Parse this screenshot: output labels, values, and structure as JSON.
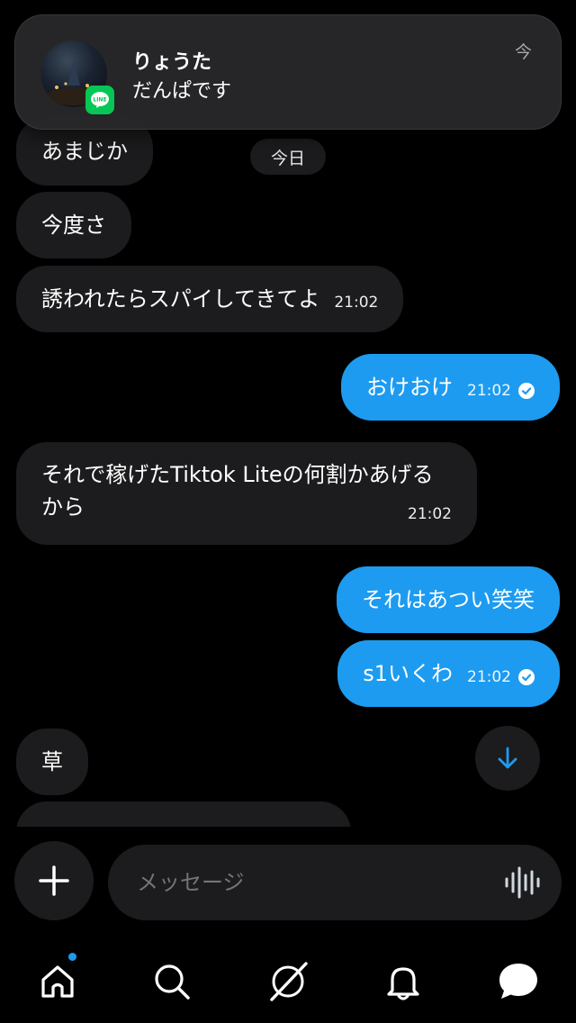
{
  "notification": {
    "sender": "りょうた",
    "message": "だんぱです",
    "time": "今",
    "app_icon": "line-icon",
    "app_badge_text": "LINE"
  },
  "day_separator": "今日",
  "messages": [
    {
      "side": "in",
      "text": "あまじか",
      "time": ""
    },
    {
      "side": "in",
      "text": "今度さ",
      "time": ""
    },
    {
      "side": "in",
      "text": "誘われたらスパイしてきてよ",
      "time": "21:02"
    },
    {
      "side": "out",
      "text": "おけおけ",
      "time": "21:02",
      "read": true
    },
    {
      "side": "in",
      "text": "それで稼げたTiktok Liteの何割かあげるから",
      "time": "21:02"
    },
    {
      "side": "out",
      "text": "それはあつい笑笑",
      "time": ""
    },
    {
      "side": "out",
      "text": "s1いくわ",
      "time": "21:02",
      "read": true
    },
    {
      "side": "in",
      "text": "草",
      "time": ""
    }
  ],
  "composer": {
    "placeholder": "メッセージ",
    "add_icon": "plus-icon",
    "voice_icon": "voice-wave-icon"
  },
  "nav": {
    "items": [
      "home-icon",
      "search-icon",
      "grok-icon",
      "bell-icon",
      "messages-icon"
    ],
    "home_has_dot": true
  },
  "colors": {
    "accent": "#1d9bf0",
    "incoming_bubble": "#1c1c1e",
    "line_green": "#06c755"
  }
}
